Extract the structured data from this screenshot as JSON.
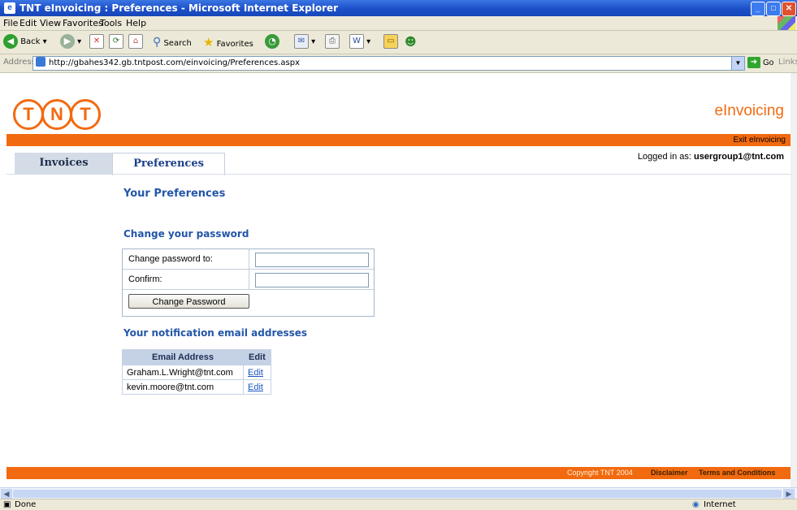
{
  "window": {
    "title": "TNT eInvoicing : Preferences - Microsoft Internet Explorer",
    "controls": [
      "minimize",
      "maximize",
      "close"
    ]
  },
  "menu": [
    "File",
    "Edit",
    "View",
    "Favorites",
    "Tools",
    "Help"
  ],
  "toolbar": {
    "back_label": "Back",
    "search_label": "Search",
    "favorites_label": "Favorites"
  },
  "address": {
    "label": "Address",
    "url": "http://gbahes342.gb.tntpost.com/einvoicing/Preferences.aspx",
    "go_label": "Go",
    "links_label": "Links"
  },
  "header": {
    "logo_text": "TNT",
    "brand": "eInvoicing",
    "exit_link": "Exit eInvoicing",
    "logged_in_label": "Logged in as:",
    "logged_in_user": "usergroup1@tnt.com"
  },
  "tabs": [
    {
      "label": "Invoices",
      "active": false
    },
    {
      "label": "Preferences",
      "active": true
    }
  ],
  "page": {
    "title": "Your Preferences",
    "password_section": {
      "heading": "Change your password",
      "change_label": "Change password to:",
      "confirm_label": "Confirm:",
      "change_value": "",
      "confirm_value": "",
      "button_label": "Change Password"
    },
    "email_section": {
      "heading": "Your notification email addresses",
      "columns": [
        "Email Address",
        "Edit"
      ],
      "rows": [
        {
          "email": "Graham.L.Wright@tnt.com",
          "action": "Edit"
        },
        {
          "email": "kevin.moore@tnt.com",
          "action": "Edit"
        }
      ]
    }
  },
  "footer": {
    "copyright": "Copyright TNT 2004",
    "disclaimer": "Disclaimer",
    "terms": "Terms and Conditions"
  },
  "status": {
    "left": "Done",
    "zone": "Internet"
  },
  "colors": {
    "tnt_orange": "#f26a10",
    "heading_blue": "#2356a8",
    "title_bar_blue": "#1c4fc9"
  }
}
